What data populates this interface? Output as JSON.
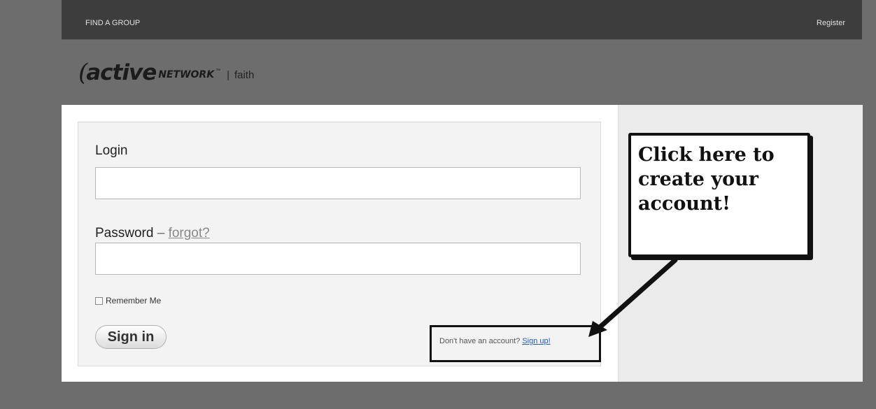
{
  "topbar": {
    "find_group": "FIND A GROUP",
    "register": "Register"
  },
  "brand": {
    "active": "active",
    "network": "NETWORK",
    "tm": "™",
    "separator": "|",
    "product": "faith"
  },
  "form": {
    "login_label": "Login",
    "password_label": "Password",
    "dash": "–",
    "forgot": "forgot?",
    "remember": "Remember Me",
    "signin": "Sign in",
    "no_account": "Don't have an account?",
    "signup": "Sign up!"
  },
  "annotation": {
    "callout": "Click here to create your account!"
  },
  "colors": {
    "background": "#6d6d6d",
    "topbar": "#3d3d3d",
    "link": "#1a5ccc"
  }
}
